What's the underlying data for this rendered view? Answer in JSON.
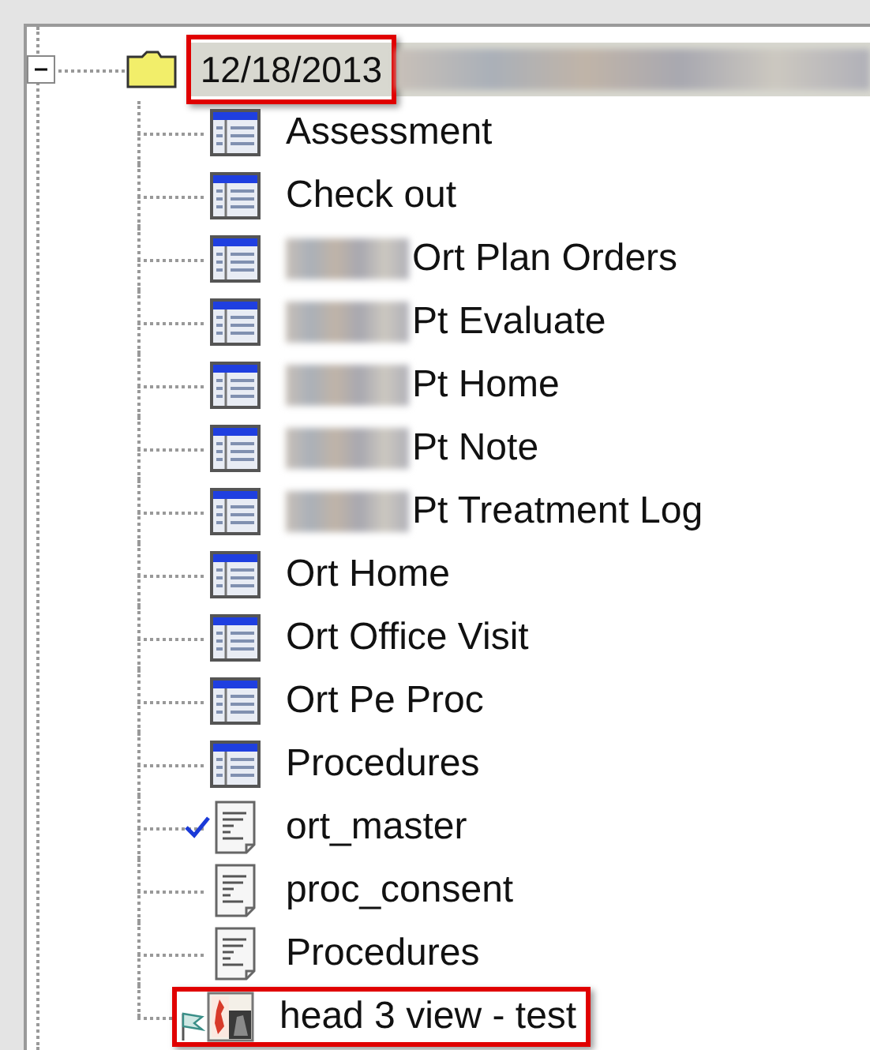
{
  "tree": {
    "root": {
      "label": "12/18/2013",
      "expanded": true,
      "selected": true,
      "highlighted": true,
      "redacted_suffix": true,
      "children": [
        {
          "kind": "form",
          "label": "Assessment",
          "redacted": false,
          "checked": false,
          "highlighted": false
        },
        {
          "kind": "form",
          "label": "Check out",
          "redacted": false,
          "checked": false,
          "highlighted": false
        },
        {
          "kind": "form",
          "label": "Ort Plan Orders",
          "redacted": true,
          "checked": false,
          "highlighted": false
        },
        {
          "kind": "form",
          "label": "Pt Evaluate",
          "redacted": true,
          "checked": false,
          "highlighted": false
        },
        {
          "kind": "form",
          "label": "Pt Home",
          "redacted": true,
          "checked": false,
          "highlighted": false
        },
        {
          "kind": "form",
          "label": "Pt Note",
          "redacted": true,
          "checked": false,
          "highlighted": false
        },
        {
          "kind": "form",
          "label": "Pt Treatment Log",
          "redacted": true,
          "checked": false,
          "highlighted": false
        },
        {
          "kind": "form",
          "label": "Ort Home",
          "redacted": false,
          "checked": false,
          "highlighted": false
        },
        {
          "kind": "form",
          "label": "Ort Office Visit",
          "redacted": false,
          "checked": false,
          "highlighted": false
        },
        {
          "kind": "form",
          "label": "Ort Pe Proc",
          "redacted": false,
          "checked": false,
          "highlighted": false
        },
        {
          "kind": "form",
          "label": "Procedures",
          "redacted": false,
          "checked": false,
          "highlighted": false
        },
        {
          "kind": "doc",
          "label": "ort_master",
          "redacted": false,
          "checked": true,
          "highlighted": false
        },
        {
          "kind": "doc",
          "label": "proc_consent",
          "redacted": false,
          "checked": false,
          "highlighted": false
        },
        {
          "kind": "doc",
          "label": "Procedures",
          "redacted": false,
          "checked": false,
          "highlighted": false
        },
        {
          "kind": "image",
          "label": "head 3 view - test",
          "redacted": false,
          "checked": false,
          "highlighted": true
        }
      ]
    }
  }
}
